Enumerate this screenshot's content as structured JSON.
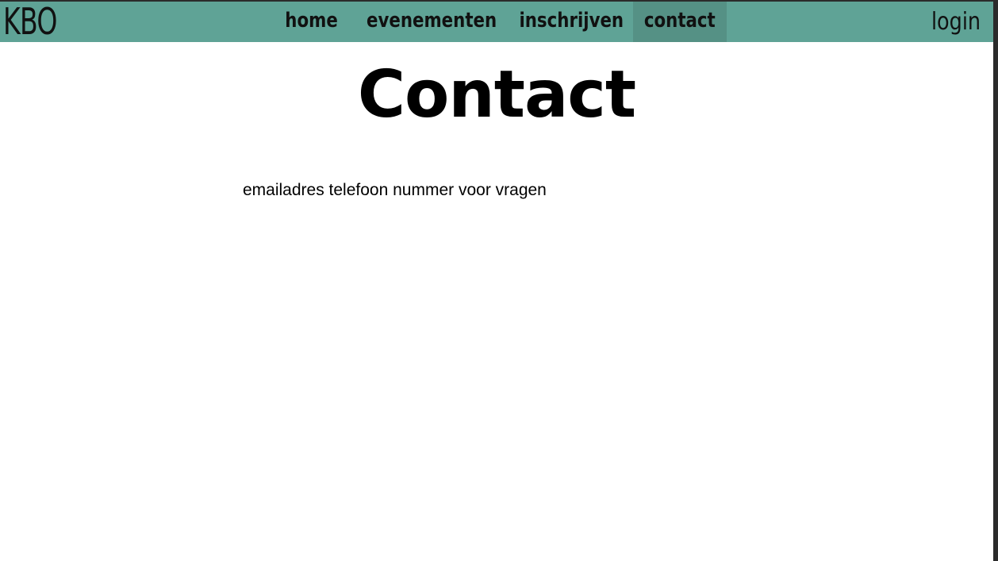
{
  "header": {
    "logo": "KBO",
    "nav": [
      {
        "label": "home",
        "active": false
      },
      {
        "label": "evenementen",
        "active": false
      },
      {
        "label": "inschrijven",
        "active": false
      },
      {
        "label": "contact",
        "active": true
      }
    ],
    "login_label": "login"
  },
  "main": {
    "title": "Contact",
    "body_text": "emailadres telefoon nummer voor vragen"
  },
  "colors": {
    "navbar_bg": "#5fa396",
    "nav_active_bg": "#559185",
    "text": "#111111",
    "background": "#ffffff"
  }
}
